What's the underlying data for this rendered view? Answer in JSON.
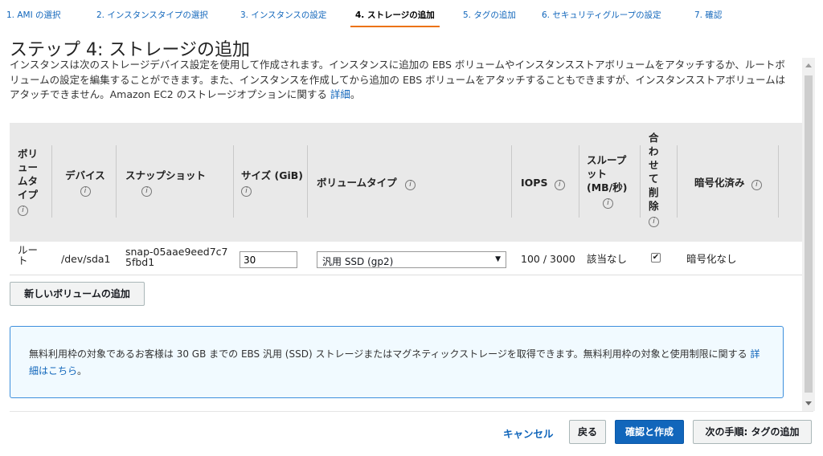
{
  "tabs": [
    {
      "label": "1. AMI の選択"
    },
    {
      "label": "2. インスタンスタイプの選択"
    },
    {
      "label": "3. インスタンスの設定"
    },
    {
      "label": "4. ストレージの追加"
    },
    {
      "label": "5. タグの追加"
    },
    {
      "label": "6. セキュリティグループの設定"
    },
    {
      "label": "7. 確認"
    }
  ],
  "page": {
    "title": "ステップ 4: ストレージの追加",
    "description": "インスタンスは次のストレージデバイス設定を使用して作成されます。インスタンスに追加の EBS ボリュームやインスタンスストアボリュームをアタッチするか、ルートボリュームの設定を編集することができます。また、インスタンスを作成してから追加の EBS ボリュームをアタッチすることもできますが、インスタンスストアボリュームはアタッチできません。Amazon EC2 のストレージオプションに関する",
    "details_link": "詳細",
    "period": "。"
  },
  "table": {
    "headers": {
      "volume_type_col": "ボリュームタイプ",
      "device": "デバイス",
      "snapshot": "スナップショット",
      "size": "サイズ (GiB)",
      "volume_type": "ボリュームタイプ",
      "iops": "IOPS",
      "throughput": "スループット (MB/秒)",
      "delete_on_termination": "合わせて削除",
      "encrypted": "暗号化済み"
    },
    "info_glyph": "i",
    "row": {
      "volume_type_col": "ルート",
      "device": "/dev/sda1",
      "snapshot": "snap-05aae9eed7c75fbd1",
      "size": "30",
      "volume_type": "汎用 SSD (gp2)",
      "iops": "100 / 3000",
      "throughput": "該当なし",
      "delete_on_termination": true,
      "encrypted": "暗号化なし"
    }
  },
  "add_volume_button": "新しいボリュームの追加",
  "notice": {
    "text": "無料利用枠の対象であるお客様は 30 GB までの EBS 汎用 (SSD) ストレージまたはマグネティックストレージを取得できます。無料利用枠の対象と使用制限に関する",
    "link": "詳細はこちら",
    "period": "。"
  },
  "footer": {
    "cancel": "キャンセル",
    "back": "戻る",
    "review_launch": "確認と作成",
    "next": "次の手順: タグの追加"
  }
}
